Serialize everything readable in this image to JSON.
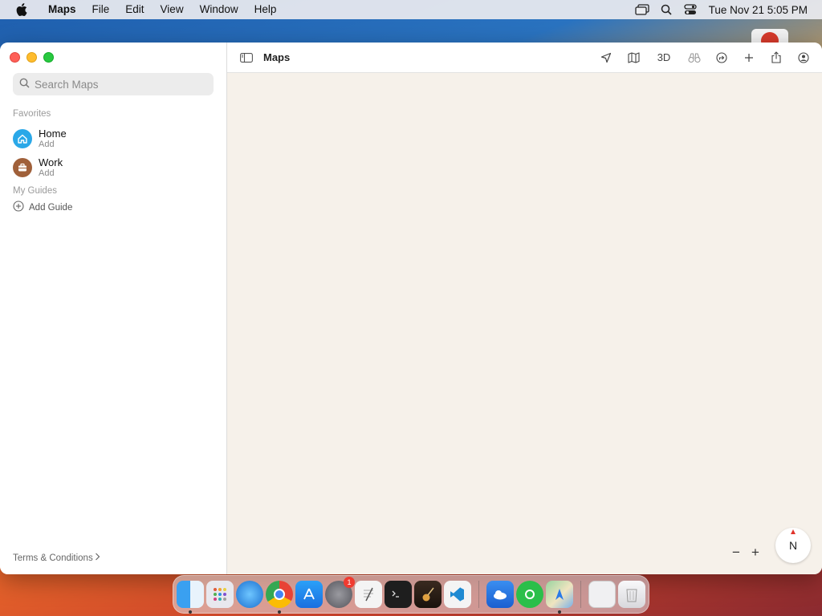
{
  "menubar": {
    "apple_icon": "apple-logo-icon",
    "app_name": "Maps",
    "items": [
      "File",
      "Edit",
      "View",
      "Window",
      "Help"
    ],
    "clock": "Tue Nov 21  5:05 PM"
  },
  "search": {
    "placeholder": "Search Maps"
  },
  "sidebar": {
    "favorites_header": "Favorites",
    "favorites": [
      {
        "title": "Home",
        "subtitle": "Add",
        "icon": "house-icon",
        "color": "#2aa8e8"
      },
      {
        "title": "Work",
        "subtitle": "Add",
        "icon": "briefcase-icon",
        "color": "#a0603a"
      }
    ],
    "guides_header": "My Guides",
    "add_guide": "Add Guide",
    "terms": "Terms & Conditions"
  },
  "toolbar": {
    "title": "Maps",
    "three_d": "3D"
  },
  "compass": {
    "label": "N"
  },
  "zoom": {
    "minus": "−",
    "plus": "+"
  },
  "dock": {
    "badge_settings": "1"
  },
  "colors": {
    "map_background": "#f6f1ea",
    "close": "#fe5f57",
    "minimize": "#febc2e",
    "maximize": "#28c840"
  }
}
